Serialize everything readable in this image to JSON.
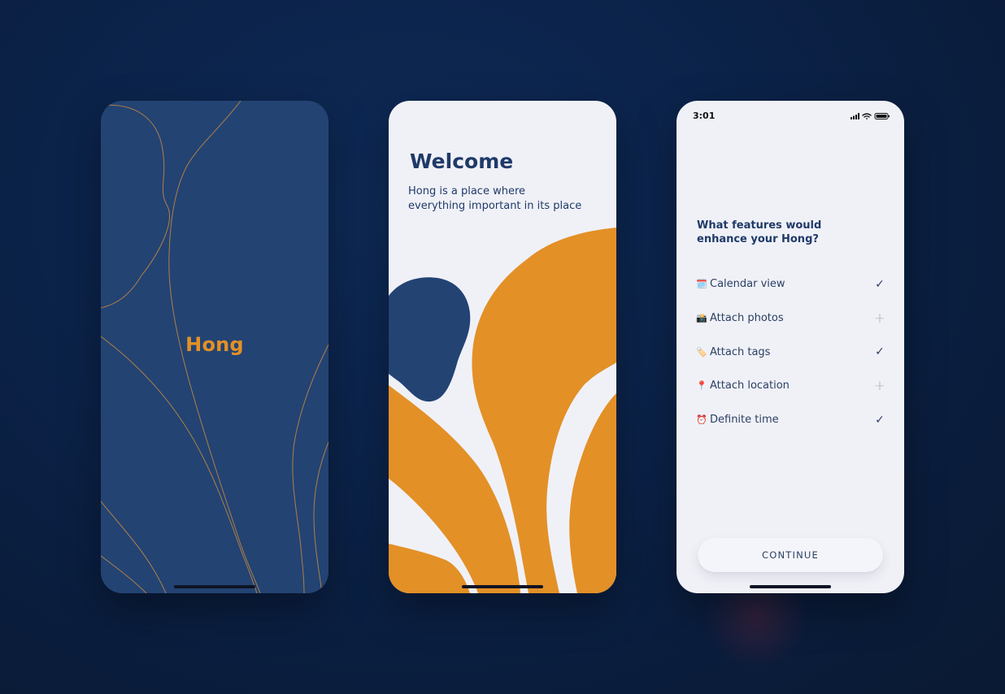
{
  "splash": {
    "app_name": "Hong",
    "bg_color": "#234373",
    "accent_color": "#e39027"
  },
  "welcome": {
    "title": "Welcome",
    "subtitle_line1": "Hong is a place where",
    "subtitle_line2": "everything important in its place",
    "orange": "#e39027",
    "navy": "#234373"
  },
  "features": {
    "status_time": "3:01",
    "question": "What features would enhance your Hong?",
    "items": [
      {
        "emoji": "🗓️",
        "label": "Calendar view",
        "selected": true
      },
      {
        "emoji": "📸",
        "label": "Attach photos",
        "selected": false
      },
      {
        "emoji": "🏷️",
        "label": "Attach tags",
        "selected": true
      },
      {
        "emoji": "📍",
        "label": "Attach location",
        "selected": false
      },
      {
        "emoji": "⏰",
        "label": "Definite time",
        "selected": true
      }
    ],
    "continue_label": "CONTINUE",
    "check_icon": "check-icon",
    "plus_icon": "plus-icon"
  }
}
